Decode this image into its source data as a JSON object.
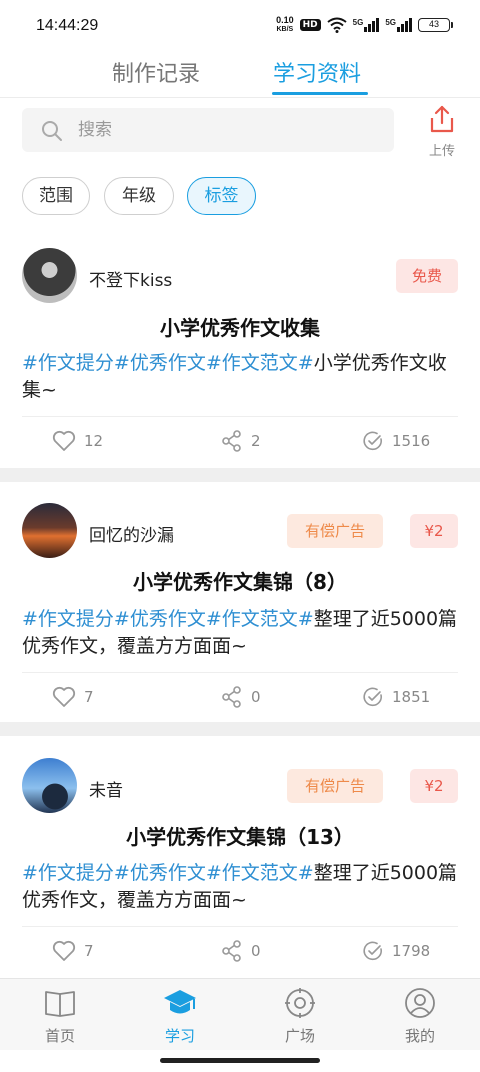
{
  "status_bar": {
    "time": "14:44:29",
    "net_speed_value": "0.10",
    "net_speed_unit": "KB/S",
    "hd_label": "HD",
    "signal1": "5G",
    "signal2": "5G",
    "battery": "43"
  },
  "top_tabs": [
    {
      "label": "制作记录",
      "active": false
    },
    {
      "label": "学习资料",
      "active": true
    }
  ],
  "search": {
    "placeholder": "搜索"
  },
  "upload": {
    "label": "上传"
  },
  "filters": [
    "范围",
    "年级",
    "标签"
  ],
  "active_filter": "标签",
  "cards": [
    {
      "user": "不登下kiss",
      "badges": [
        "免费"
      ],
      "title": "小学优秀作文收集",
      "tags": "#作文提分#优秀作文#作文范文#",
      "desc": "小学优秀作文收集~",
      "likes": "12",
      "shares": "2",
      "views": "1516"
    },
    {
      "user": "回忆的沙漏",
      "badges": [
        "有偿广告",
        "¥2"
      ],
      "title": "小学优秀作文集锦（8）",
      "tags": "#作文提分#优秀作文#作文范文#",
      "desc": "整理了近5000篇优秀作文，覆盖方方面面~",
      "likes": "7",
      "shares": "0",
      "views": "1851"
    },
    {
      "user": "未音",
      "badges": [
        "有偿广告",
        "¥2"
      ],
      "title": "小学优秀作文集锦（13）",
      "tags": "#作文提分#优秀作文#作文范文#",
      "desc": "整理了近5000篇优秀作文，覆盖方方面面~",
      "likes": "7",
      "shares": "0",
      "views": "1798"
    }
  ],
  "bottom_nav": [
    {
      "label": "首页",
      "icon": "book-icon",
      "active": false
    },
    {
      "label": "学习",
      "icon": "graduation-cap-icon",
      "active": true
    },
    {
      "label": "广场",
      "icon": "target-icon",
      "active": false
    },
    {
      "label": "我的",
      "icon": "user-icon",
      "active": false
    }
  ],
  "colors": {
    "accent": "#1a9ee0",
    "tag": "#2f8fd2",
    "free_badge_bg": "#fde6e4",
    "free_badge_text": "#e9584b",
    "ad_badge_bg": "#fde9df",
    "ad_badge_text": "#ee8a4a"
  }
}
